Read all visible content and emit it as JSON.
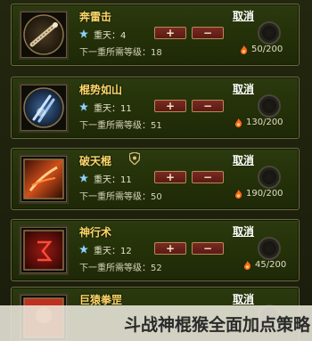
{
  "skills": [
    {
      "name": "奔雷击",
      "level_label": "重天：4",
      "requirement": "下一重所需等级：18",
      "points": "50/200",
      "cancel_label": "取消",
      "plus_label": "+",
      "minus_label": "−",
      "icon": "thunder-staff-icon",
      "has_shield": false
    },
    {
      "name": "棍势如山",
      "level_label": "重天：11",
      "requirement": "下一重所需等级：51",
      "points": "130/200",
      "cancel_label": "取消",
      "plus_label": "+",
      "minus_label": "−",
      "icon": "crossed-staffs-icon",
      "has_shield": false
    },
    {
      "name": "破天棍",
      "level_label": "重天：11",
      "requirement": "下一重所需等级：50",
      "points": "190/200",
      "cancel_label": "取消",
      "plus_label": "+",
      "minus_label": "−",
      "icon": "fire-strike-icon",
      "has_shield": true
    },
    {
      "name": "神行术",
      "level_label": "重天：12",
      "requirement": "下一重所需等级：52",
      "points": "45/200",
      "cancel_label": "取消",
      "plus_label": "+",
      "minus_label": "−",
      "icon": "red-rune-icon",
      "has_shield": false
    },
    {
      "name": "巨猿拳罡",
      "cancel_label": "取消",
      "icon": "ape-fist-icon"
    }
  ],
  "caption": "斗战神棍猴全面加点策略",
  "colors": {
    "skill_name": "#ffd86a",
    "card_bg": "#253209",
    "button_bg": "#6a2019",
    "flame": "#ff6a1a"
  }
}
